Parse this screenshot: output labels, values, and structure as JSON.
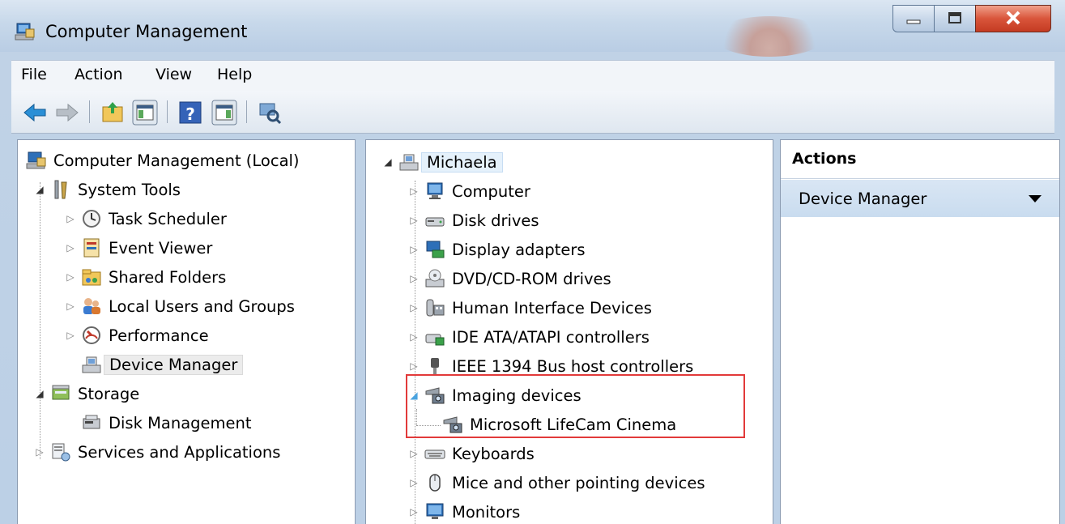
{
  "window": {
    "title": "Computer Management"
  },
  "menu": [
    "File",
    "Action",
    "View",
    "Help"
  ],
  "toolbar": {
    "icons": [
      "back-icon",
      "forward-icon",
      "up-folder-icon",
      "show-hide-console-tree-icon",
      "help-icon",
      "show-hide-action-pane-icon",
      "scan-hardware-icon"
    ]
  },
  "left_tree": {
    "root": "Computer Management (Local)",
    "system_tools": "System Tools",
    "task_scheduler": "Task Scheduler",
    "event_viewer": "Event Viewer",
    "shared_folders": "Shared Folders",
    "local_users": "Local Users and Groups",
    "performance": "Performance",
    "device_manager": "Device Manager",
    "storage": "Storage",
    "disk_management": "Disk Management",
    "services": "Services and Applications"
  },
  "device_tree": {
    "root": "Michaela",
    "items": [
      "Computer",
      "Disk drives",
      "Display adapters",
      "DVD/CD-ROM drives",
      "Human Interface Devices",
      "IDE ATA/ATAPI controllers",
      "IEEE 1394 Bus host controllers",
      "Imaging devices",
      "Microsoft LifeCam Cinema",
      "Keyboards",
      "Mice and other pointing devices",
      "Monitors"
    ]
  },
  "actions": {
    "header": "Actions",
    "item": "Device Manager"
  }
}
